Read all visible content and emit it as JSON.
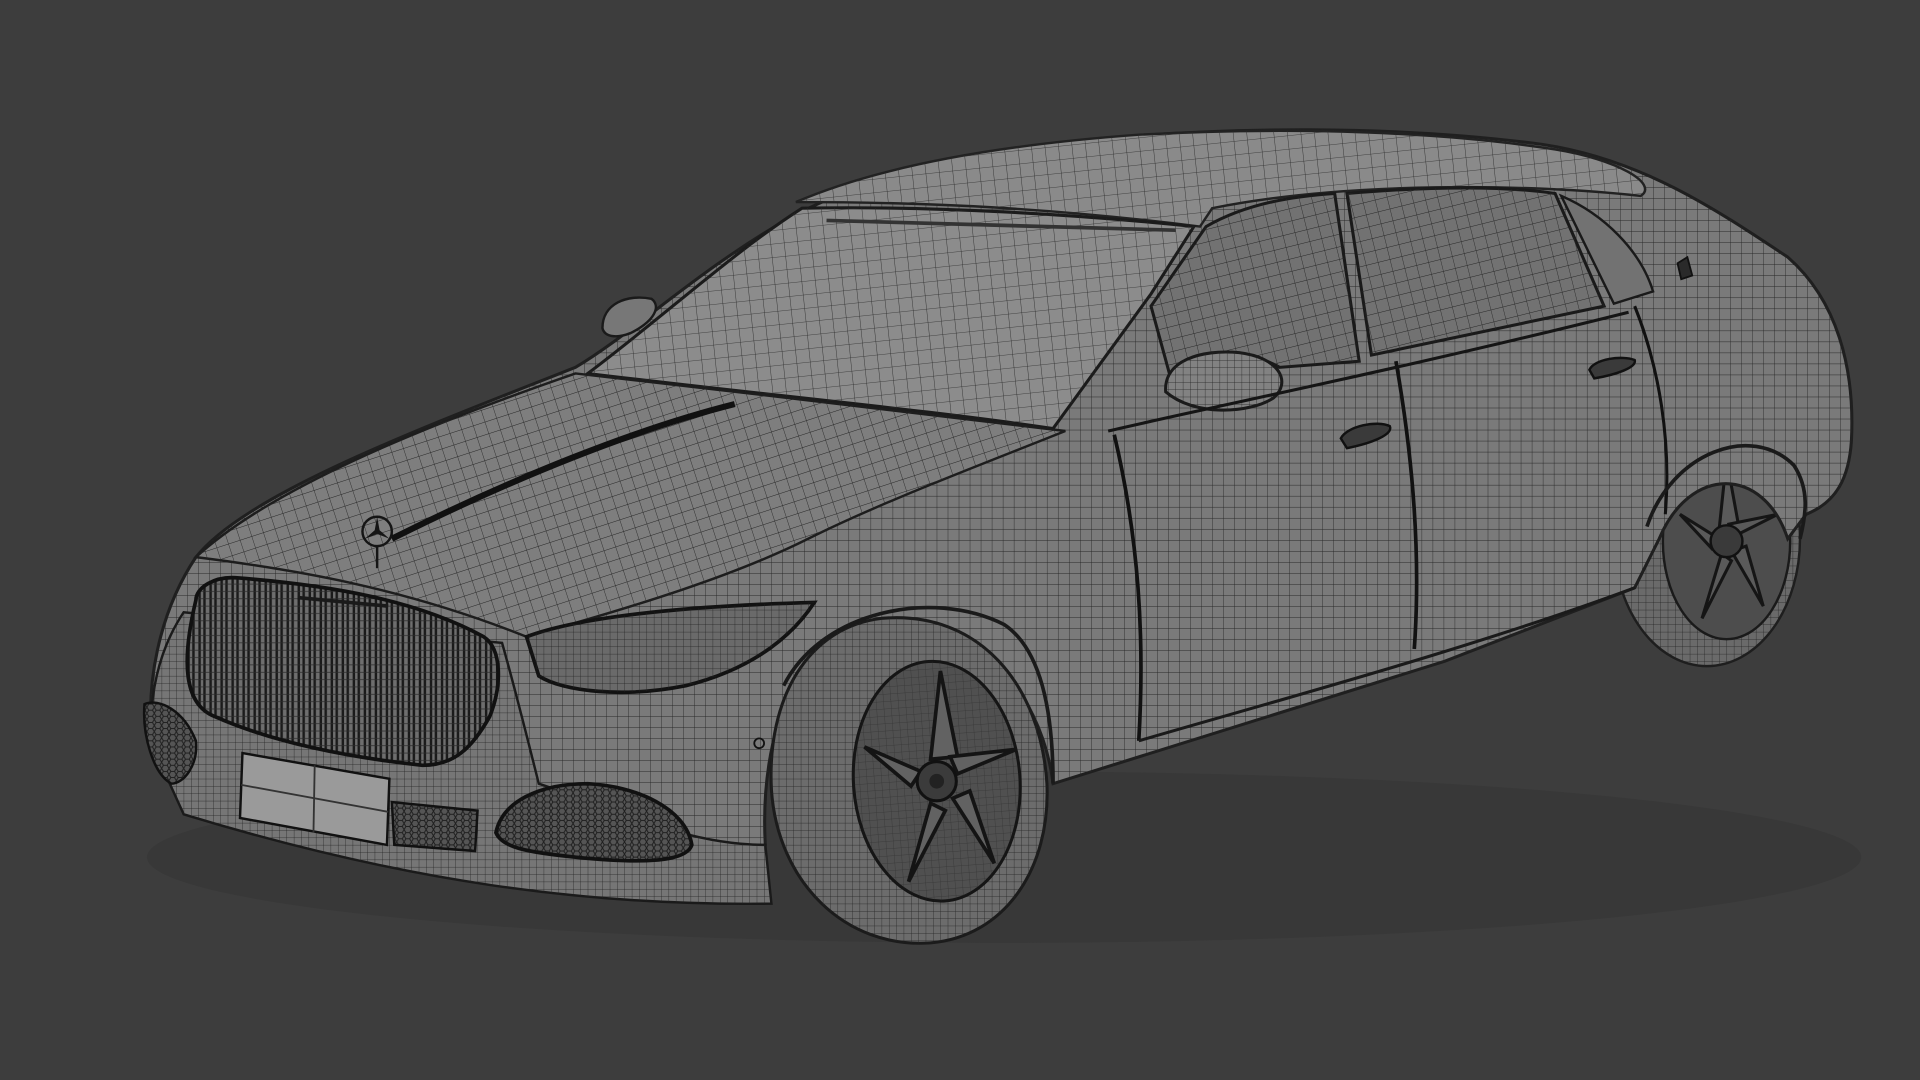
{
  "viewport": {
    "background_color": "#3d3d3d",
    "model": {
      "name": "car-wireframe-model",
      "shading": "wireframe",
      "surface_color": "#7a7a7a",
      "wire_color": "#2a2a2a"
    }
  }
}
